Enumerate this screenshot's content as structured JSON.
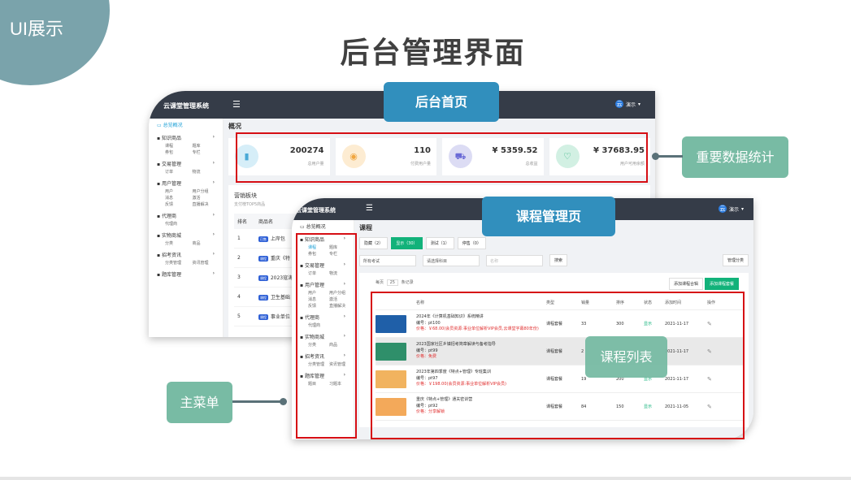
{
  "slide": {
    "corner_label": "UI展示",
    "title": "后台管理界面"
  },
  "callouts": {
    "dashboard": "后台首页",
    "course_page": "课程管理页",
    "stats": "重要数据统计",
    "course_list": "课程列表",
    "main_menu": "主菜单"
  },
  "dashboard": {
    "system_name": "云课堂管理系统",
    "user": "演示",
    "avatar_letter": "云",
    "overview_title": "概况",
    "sidebar": {
      "overview": "总览概况",
      "groups": [
        {
          "label": "知识商品",
          "subs": [
            "课程",
            "题库",
            "券包",
            "专栏"
          ]
        },
        {
          "label": "交易管理",
          "subs": [
            "订单",
            "物流"
          ]
        },
        {
          "label": "用户管理",
          "subs": [
            "用户",
            "用户分组",
            "消息",
            "激活",
            "反馈",
            "直播解决"
          ]
        },
        {
          "label": "代理商",
          "subs": [
            "代理商"
          ]
        },
        {
          "label": "实物商城",
          "subs": [
            "分类",
            "商品"
          ]
        },
        {
          "label": "招考资讯",
          "subs": [
            "分类管理",
            "资讯管理"
          ]
        },
        {
          "label": "题库管理",
          "subs": []
        }
      ]
    },
    "stats": [
      {
        "value": "200274",
        "label": "总用户量",
        "icon": "bar-chart-icon"
      },
      {
        "value": "110",
        "label": "付费用户量",
        "icon": "eye-icon"
      },
      {
        "value": "¥ 5359.52",
        "label": "总收益",
        "icon": "cart-icon"
      },
      {
        "value": "¥ 37683.95",
        "label": "用户可用余额",
        "icon": "heart-icon"
      }
    ],
    "market": {
      "title": "营销板块",
      "subtitle": "支付榜TOP5商品",
      "col_rank": "排名",
      "col_name": "商品名",
      "rows": [
        {
          "rank": "1",
          "tag": "已售",
          "name": "上岸包"
        },
        {
          "rank": "2",
          "tag": "课程",
          "name": "重庆《特"
        },
        {
          "rank": "3",
          "tag": "课程",
          "name": "2023寇涛"
        },
        {
          "rank": "4",
          "tag": "课程",
          "name": "卫生基础"
        },
        {
          "rank": "5",
          "tag": "课程",
          "name": "事业单位"
        }
      ]
    }
  },
  "course": {
    "system_name": "云课堂管理系统",
    "user": "演示",
    "avatar_letter": "云",
    "page_title": "课程",
    "sidebar": {
      "overview": "总览概况",
      "groups": [
        {
          "label": "知识商品",
          "subs": [
            "课程",
            "题库",
            "券包",
            "专栏"
          ]
        },
        {
          "label": "交易管理",
          "subs": [
            "订单",
            "物流"
          ]
        },
        {
          "label": "用户管理",
          "subs": [
            "用户",
            "用户分组",
            "消息",
            "激活",
            "反馈",
            "直播解决"
          ]
        },
        {
          "label": "代理商",
          "subs": [
            "代理商"
          ]
        },
        {
          "label": "实物商城",
          "subs": [
            "分类",
            "商品"
          ]
        },
        {
          "label": "招考资讯",
          "subs": [
            "分类管理",
            "资讯管理"
          ]
        },
        {
          "label": "题库管理",
          "subs": [
            "题目",
            "习题本"
          ]
        }
      ]
    },
    "tabs": [
      "隐藏（2）",
      "显示（30）",
      "测试（1）",
      "停售（0）"
    ],
    "active_tab": 1,
    "filter_exam": "所有考试",
    "filter_subject": "请选择科目",
    "search_placeholder": "名称",
    "search_button": "搜索",
    "manage_category": "管理分类",
    "page_size_label": "每页",
    "page_size": "25",
    "page_size_suffix": "条记录",
    "add_group_button": "添加课程合辑",
    "add_course_button": "添加课程套餐",
    "columns": [
      "名称",
      "类型",
      "销量",
      "排序",
      "状态",
      "添加时间",
      "操作"
    ],
    "rows": [
      {
        "name": "2024年《计算机基础知识》系统精讲",
        "code": "编号：pt100",
        "price": "价格：￥68.00(会员资源:事业单位解析VIP会员,云课堂字幕80年份)",
        "type": "课程套餐",
        "sales": "33",
        "order": "300",
        "status": "显示",
        "date": "2021-11-17",
        "thumb": "#1f5fa8"
      },
      {
        "name": "2023国家社区乡镇招考简章解读与备考指导",
        "code": "编号：pt99",
        "price": "价格：免费",
        "type": "课程套餐",
        "sales": "2",
        "order": "",
        "status": "",
        "date": "2021-11-17",
        "thumb": "#2f8f6a"
      },
      {
        "name": "2023年第四季度《特点+管理》专班集训",
        "code": "编号：pt97",
        "price": "价格：￥198.00(会员资源:事业单位解析VIP会员)",
        "type": "课程套餐",
        "sales": "19",
        "order": "200",
        "status": "显示",
        "date": "2021-11-17",
        "thumb": "#f1b35f"
      },
      {
        "name": "重庆《特点+管理》通关密训营",
        "code": "编号：pt92",
        "price": "价格：分享解锁",
        "type": "课程套餐",
        "sales": "84",
        "order": "150",
        "status": "显示",
        "date": "2021-11-05",
        "thumb": "#f3a95a"
      }
    ]
  }
}
